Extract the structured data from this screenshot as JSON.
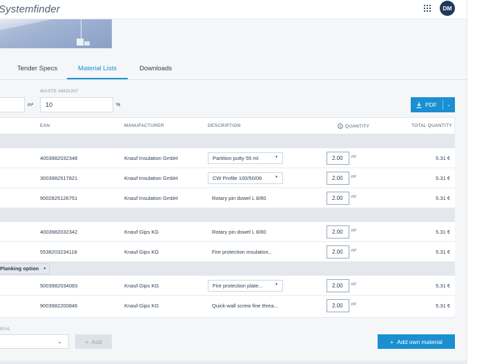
{
  "header": {
    "brand": "Systemfinder",
    "apps_icon": "grid-icon",
    "avatar_initials": "DM"
  },
  "tabs": [
    {
      "label": "Tender Specs",
      "active": false
    },
    {
      "label": "Material Lists",
      "active": true
    },
    {
      "label": "Downloads",
      "active": false
    }
  ],
  "controls": {
    "area_unit": "m²",
    "waste_label": "WASTE AMOUNT",
    "waste_value": "10",
    "waste_unit": "%",
    "pdf_label": "PDF"
  },
  "table": {
    "columns": {
      "ean": "EAN",
      "manufacturer": "MANUFACTURER",
      "description": "DESCRIPTION",
      "quantity": "QUANTITY",
      "total": "TOTAL QUANTITY"
    },
    "planking_option": "Planking option",
    "rows": [
      {
        "ean": "4003982032348",
        "manufacturer": "Knauf Insulation GmbH",
        "description": "Partition putty 55 ml",
        "select": true,
        "quantity": "2.00",
        "unit": "m²",
        "total": "5.31 €"
      },
      {
        "ean": "3003982517821",
        "manufacturer": "Knauf Insulation GmbH",
        "description": "CW Profile 100/50/06",
        "select": true,
        "quantity": "2.00",
        "unit": "m²",
        "total": "5.31 €"
      },
      {
        "ean": "9002825126751",
        "manufacturer": "Knauf Insulation GmbH",
        "description": "Rotary pin dowel L 8/80",
        "select": false,
        "quantity": "2.00",
        "unit": "m²",
        "total": "5.31 €"
      },
      {
        "ean": "4003982032342",
        "manufacturer": "Knauf Gips KG",
        "description": "Rotary pin dowel L 8/80",
        "select": false,
        "quantity": "2.00",
        "unit": "m²",
        "total": "5.31 €"
      },
      {
        "ean": "5538203234118",
        "manufacturer": "Knauf Gips KG",
        "description": "Fire protection insulation...",
        "select": false,
        "quantity": "2.00",
        "unit": "m²",
        "total": "5.31 €"
      },
      {
        "ean": "5003982034083",
        "manufacturer": "Knauf Gips KG",
        "description": "Fire protection plate...",
        "select": true,
        "quantity": "2.00",
        "unit": "m²",
        "total": "5.31 €"
      },
      {
        "ean": "9003982200846",
        "manufacturer": "Knauf Gips KG",
        "description": "Quick-wall screw fine threa...",
        "select": false,
        "quantity": "2.00",
        "unit": "m²",
        "total": "5.31 €"
      }
    ]
  },
  "bottom": {
    "material_label": "RIAL",
    "add_label": "Add",
    "add_own_label": "Add own material"
  },
  "colors": {
    "accent": "#1a8fd1",
    "navy": "#1f3a5a",
    "group_bg": "#e4e7ec"
  }
}
